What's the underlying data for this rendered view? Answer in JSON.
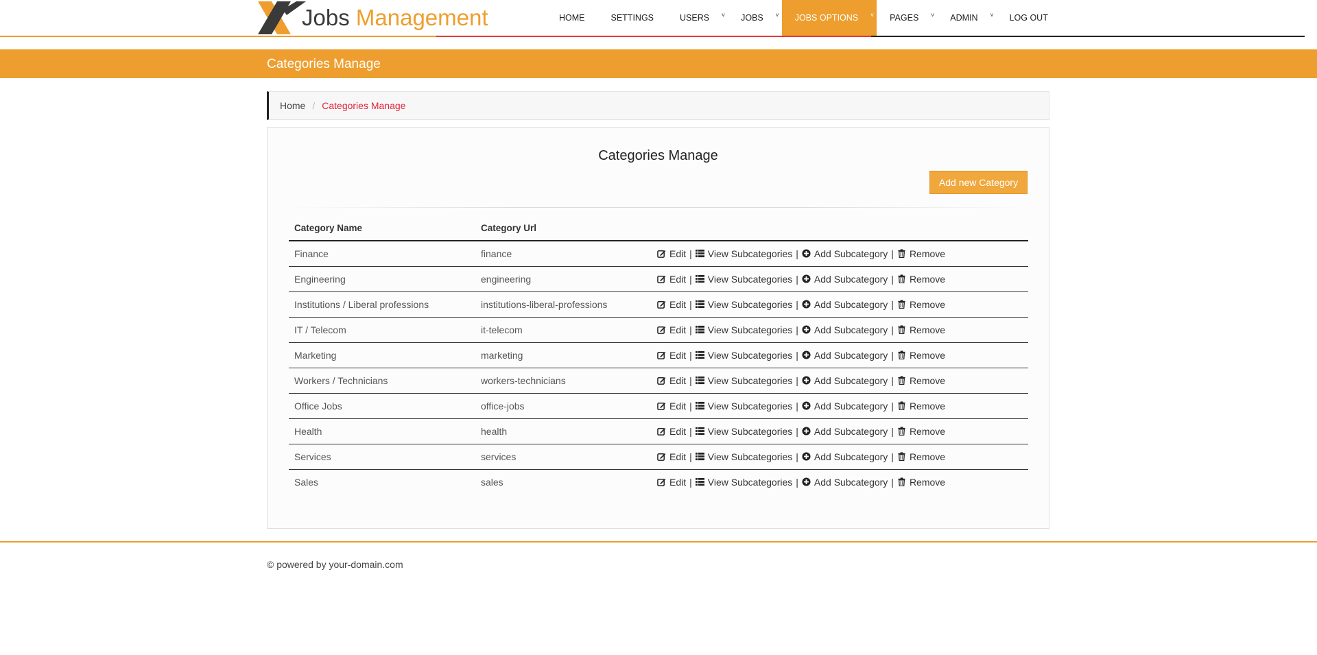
{
  "header": {
    "logo_word1": "Jobs",
    "logo_word2": "Management",
    "nav": [
      {
        "label": "HOME",
        "caret": false,
        "active": false
      },
      {
        "label": "SETTINGS",
        "caret": false,
        "active": false
      },
      {
        "label": "USERS",
        "caret": true,
        "active": false
      },
      {
        "label": "JOBS",
        "caret": true,
        "active": false
      },
      {
        "label": "JOBS OPTIONS",
        "caret": true,
        "active": true
      },
      {
        "label": "PAGES",
        "caret": true,
        "active": false
      },
      {
        "label": "ADMIN",
        "caret": true,
        "active": false
      },
      {
        "label": "LOG OUT",
        "caret": false,
        "active": false
      }
    ]
  },
  "page": {
    "band_title": "Categories Manage",
    "breadcrumb": {
      "home": "Home",
      "separator": "/",
      "current": "Categories Manage"
    },
    "panel_title": "Categories Manage",
    "add_button": "Add new Category"
  },
  "table": {
    "headers": [
      "Category Name",
      "Category Url",
      ""
    ],
    "actions": {
      "edit": "Edit",
      "view": "View Subcategories",
      "add": "Add Subcategory",
      "remove": "Remove",
      "separator": "|"
    },
    "rows": [
      {
        "name": "Finance",
        "url": "finance"
      },
      {
        "name": "Engineering",
        "url": "engineering"
      },
      {
        "name": "Institutions / Liberal professions",
        "url": "institutions-liberal-professions"
      },
      {
        "name": "IT / Telecom",
        "url": "it-telecom"
      },
      {
        "name": "Marketing",
        "url": "marketing"
      },
      {
        "name": "Workers / Technicians",
        "url": "workers-technicians"
      },
      {
        "name": "Office Jobs",
        "url": "office-jobs"
      },
      {
        "name": "Health",
        "url": "health"
      },
      {
        "name": "Services",
        "url": "services"
      },
      {
        "name": "Sales",
        "url": "sales"
      }
    ]
  },
  "footer": {
    "text": "© powered by your-domain.com"
  },
  "colors": {
    "accent": "#ee9e2e",
    "breadcrumb_current": "#e2233a",
    "button": "#f0a73c"
  },
  "icons": {
    "edit": "edit-icon",
    "view": "list-icon",
    "add": "plus-circle-icon",
    "remove": "trash-icon"
  }
}
